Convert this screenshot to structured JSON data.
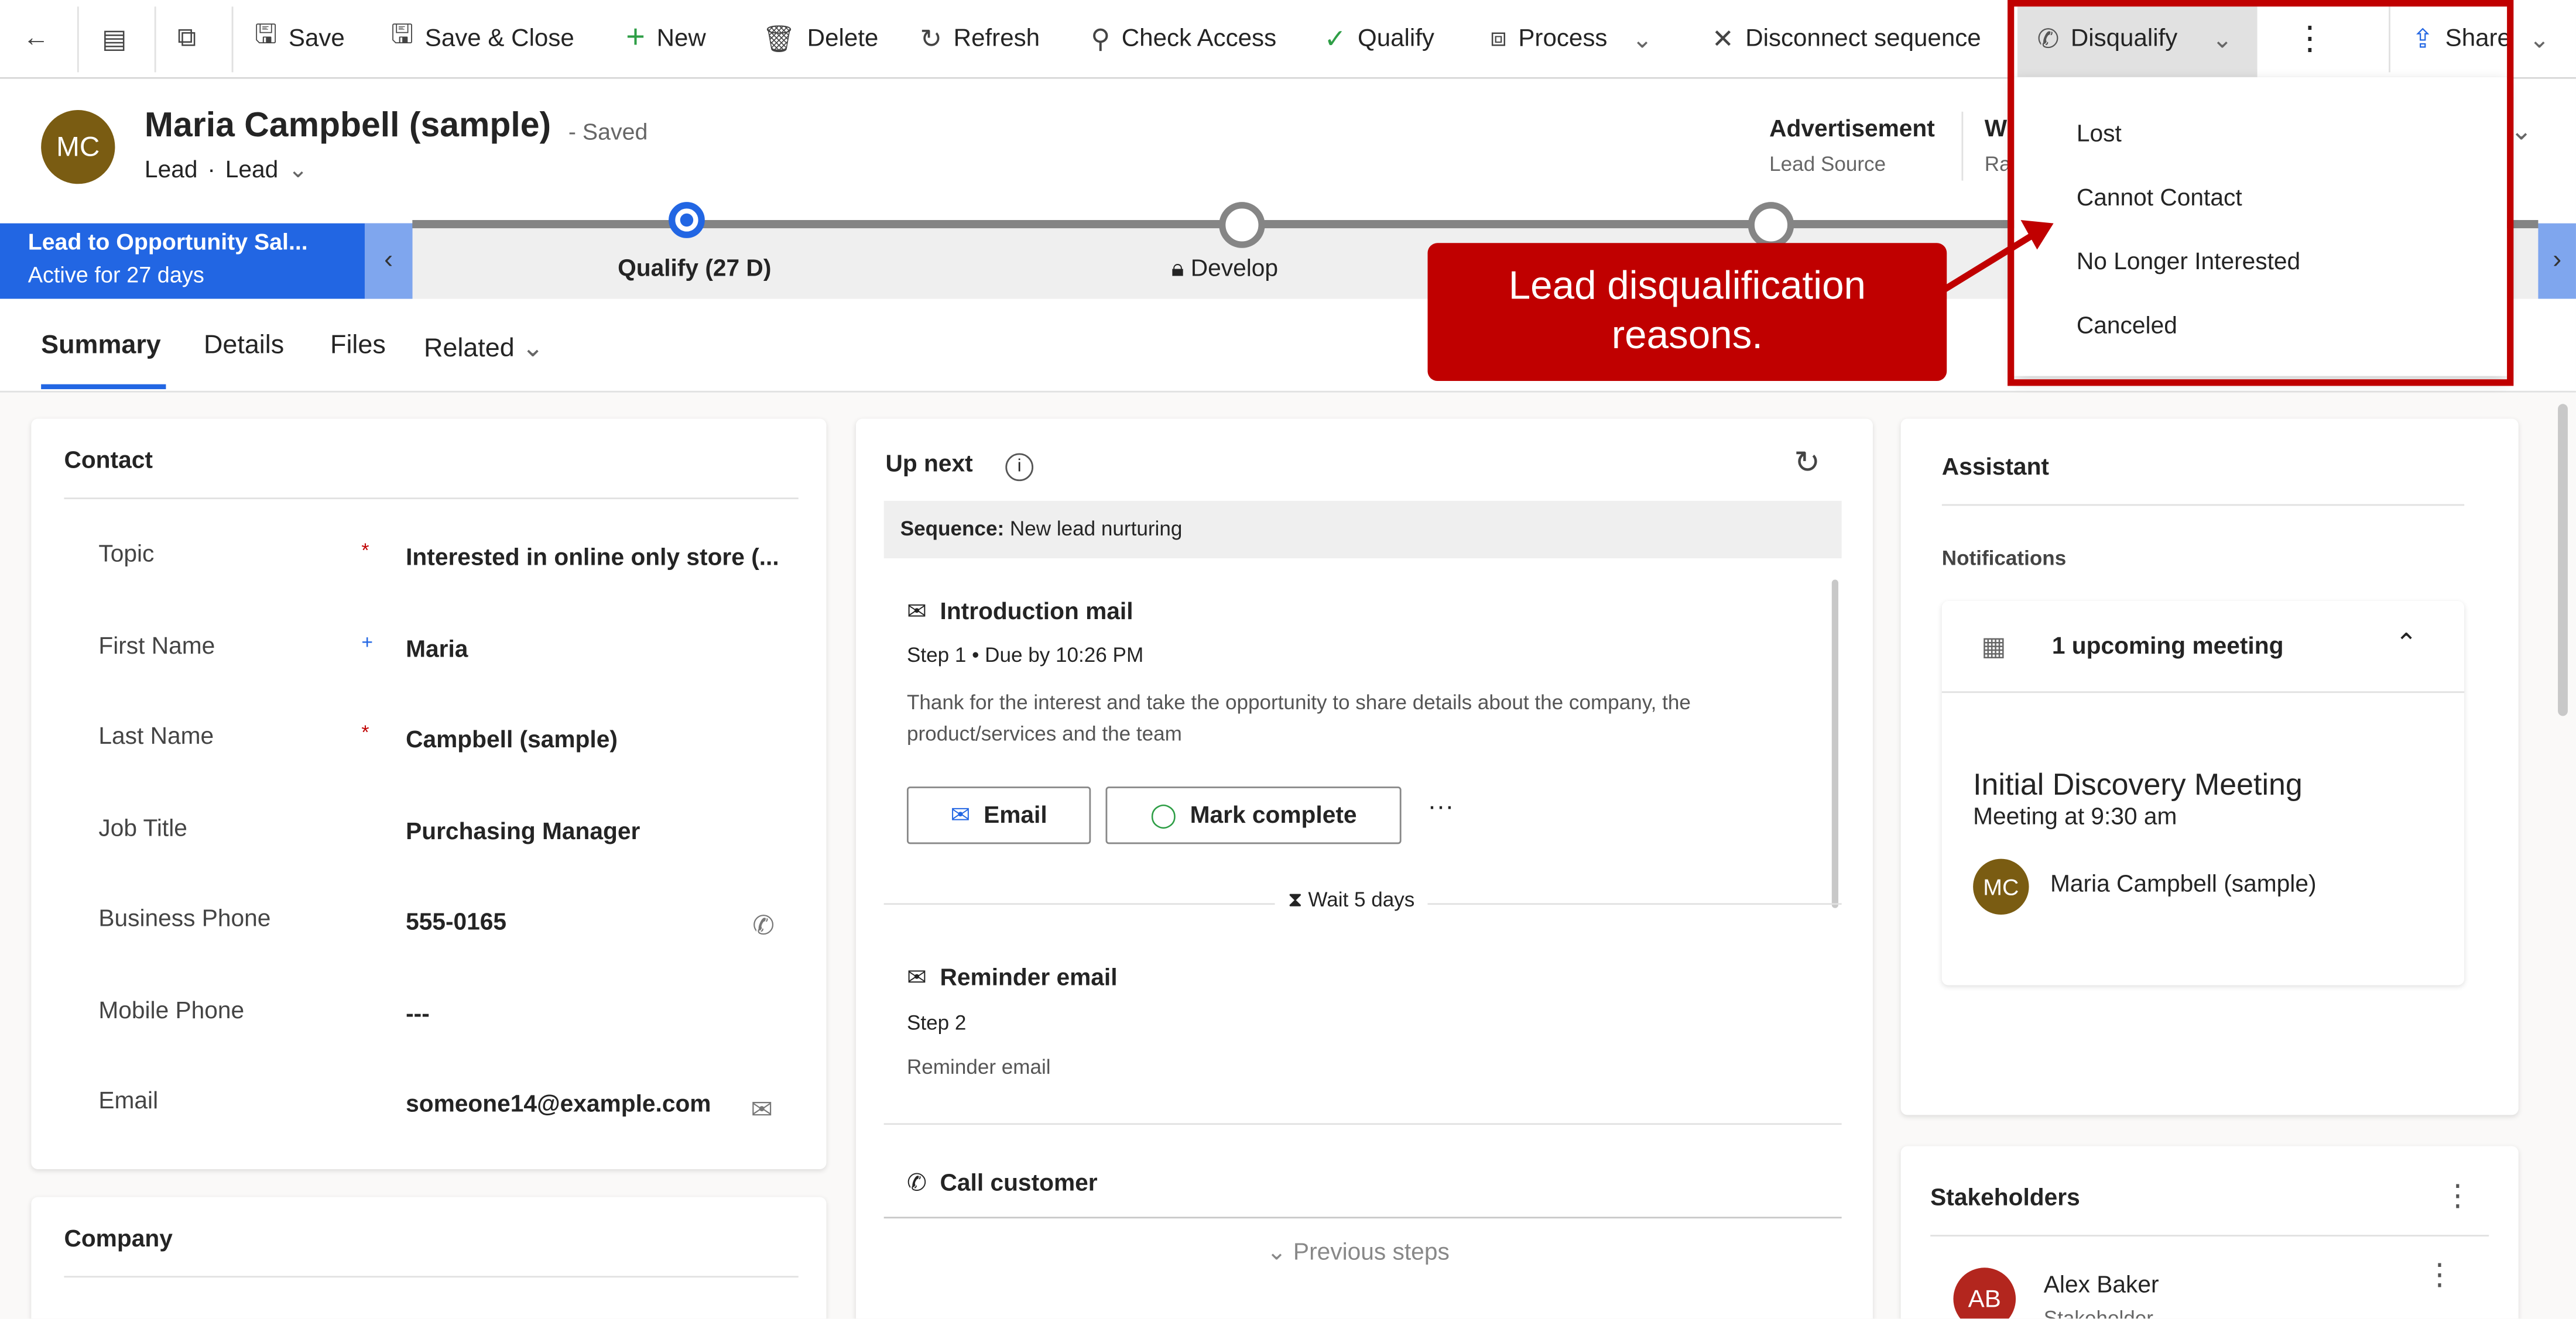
{
  "toolbar": {
    "save": "Save",
    "save_close": "Save & Close",
    "new": "New",
    "delete": "Delete",
    "refresh": "Refresh",
    "check_access": "Check Access",
    "qualify": "Qualify",
    "process": "Process",
    "disconnect": "Disconnect sequence",
    "disqualify": "Disqualify",
    "share": "Share"
  },
  "disqualify_menu": [
    "Lost",
    "Cannot Contact",
    "No Longer Interested",
    "Canceled"
  ],
  "callout": "Lead disqualification reasons.",
  "header": {
    "initials": "MC",
    "name": "Maria Campbell (sample)",
    "saved": "- Saved",
    "entity": "Lead",
    "form": "Lead",
    "lead_source_value": "Advertisement",
    "lead_source_label": "Lead Source",
    "rating_value": "W",
    "rating_label": "Ra"
  },
  "bpf": {
    "name": "Lead to Opportunity Sal...",
    "active": "Active for 27 days",
    "stage1": "Qualify  (27 D)",
    "stage2": "Develop"
  },
  "tabs": [
    "Summary",
    "Details",
    "Files",
    "Related"
  ],
  "contact": {
    "title": "Contact",
    "fields": [
      {
        "label": "Topic",
        "value": "Interested in online only store (..."
      },
      {
        "label": "First Name",
        "value": "Maria"
      },
      {
        "label": "Last Name",
        "value": "Campbell (sample)"
      },
      {
        "label": "Job Title",
        "value": "Purchasing Manager"
      },
      {
        "label": "Business Phone",
        "value": "555-0165"
      },
      {
        "label": "Mobile Phone",
        "value": "---"
      },
      {
        "label": "Email",
        "value": "someone14@example.com"
      }
    ]
  },
  "company": {
    "title": "Company"
  },
  "upnext": {
    "title": "Up next",
    "sequence_label": "Sequence:",
    "sequence": "New lead nurturing",
    "step1": {
      "title": "Introduction mail",
      "meta": "Step 1 • Due by 10:26 PM",
      "desc": "Thank for the interest and take the opportunity to share details about the company, the product/services and the team",
      "email_btn": "Email",
      "complete_btn": "Mark complete"
    },
    "wait": "Wait 5 days",
    "step2": {
      "title": "Reminder email",
      "meta": "Step 2",
      "desc": "Reminder email"
    },
    "step3": {
      "title": "Call customer"
    },
    "previous": "Previous steps"
  },
  "assistant": {
    "title": "Assistant",
    "notifications": "Notifications",
    "upcoming": "1 upcoming meeting",
    "meeting_title": "Initial Discovery Meeting",
    "meeting_time": "Meeting at 9:30 am",
    "attendee_initials": "MC",
    "attendee": "Maria Campbell (sample)"
  },
  "stakeholders": {
    "title": "Stakeholders",
    "name": "Alex Baker",
    "initials": "AB",
    "role": "Stakeholder"
  },
  "colors": {
    "accent": "#2266e3",
    "callout": "#c00000",
    "avatar": "#7a5c12"
  }
}
